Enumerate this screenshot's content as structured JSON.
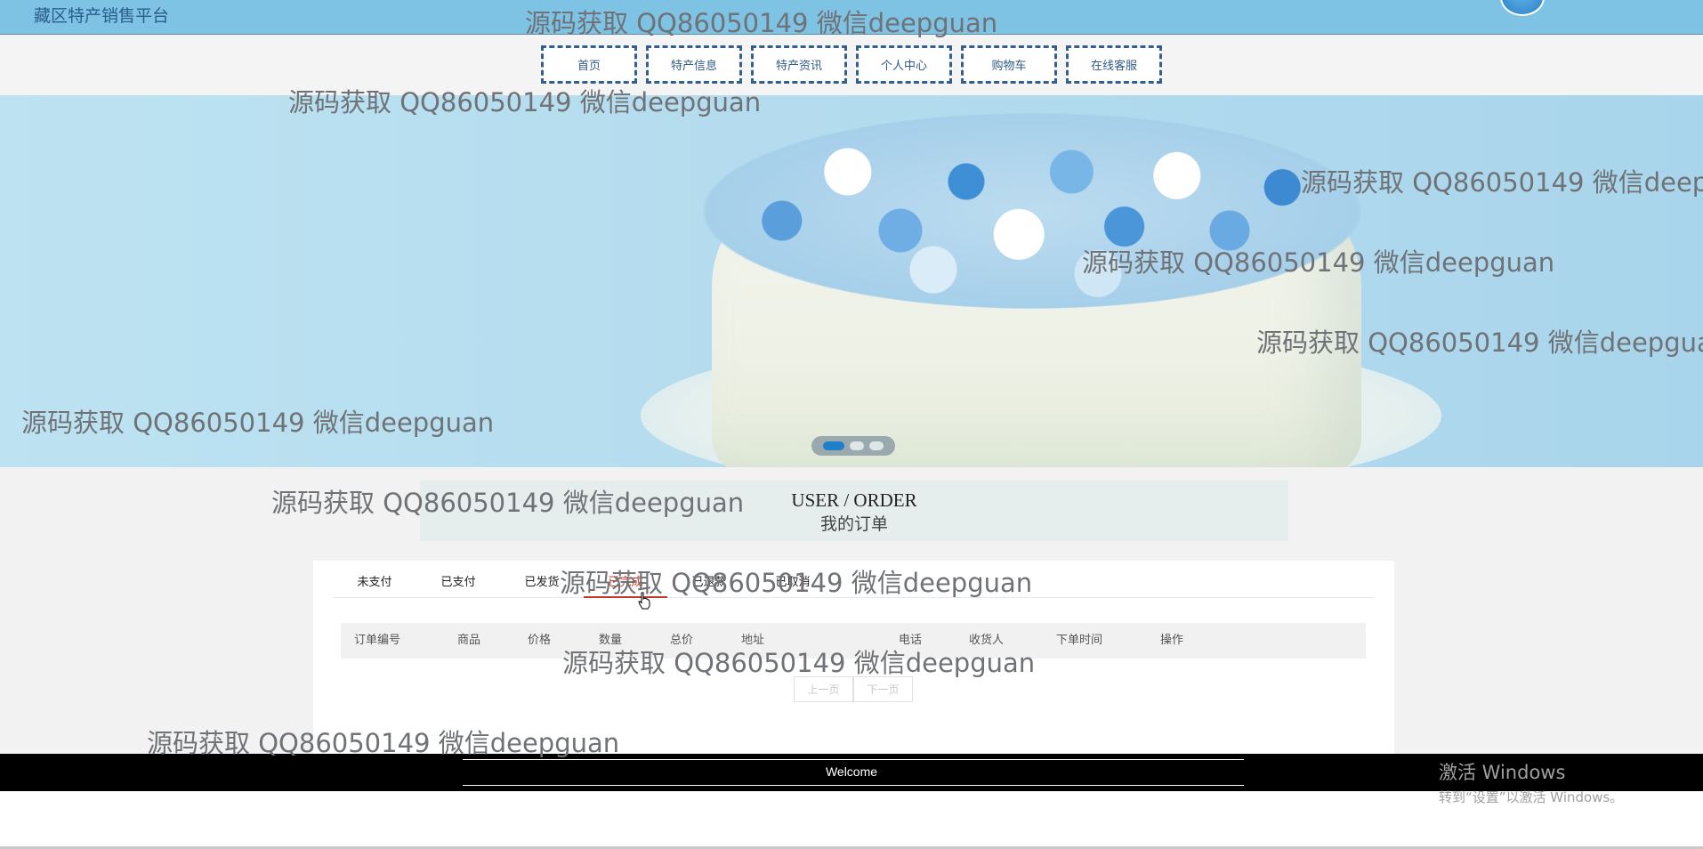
{
  "header": {
    "site_title": "藏区特产销售平台"
  },
  "nav": {
    "items": [
      "首页",
      "特产信息",
      "特产资讯",
      "个人中心",
      "购物车",
      "在线客服"
    ]
  },
  "banner": {
    "slide_count": 3,
    "active_slide": 1
  },
  "section": {
    "en_title": "USER / ORDER",
    "cn_title": "我的订单"
  },
  "orders": {
    "tabs": [
      "未支付",
      "已支付",
      "已发货",
      "已完成",
      "已退款",
      "已取消"
    ],
    "active_tab": "已完成",
    "columns": [
      "订单编号",
      "商品",
      "价格",
      "数量",
      "总价",
      "地址",
      "电话",
      "收货人",
      "下单时间",
      "操作"
    ],
    "rows": []
  },
  "pagination": {
    "prev_label": "上一页",
    "next_label": "下一页"
  },
  "footer": {
    "text": "Welcome"
  },
  "windows": {
    "activate_title": "激活 Windows",
    "activate_sub": "转到“设置”以激活 Windows。"
  },
  "watermark": {
    "text": "源码获取 QQ86050149 微信deepguan"
  },
  "colors": {
    "topbar": "#7ec2e4",
    "nav_border": "#335f8c",
    "active_tab": "#c0392b",
    "footer": "#000000"
  }
}
